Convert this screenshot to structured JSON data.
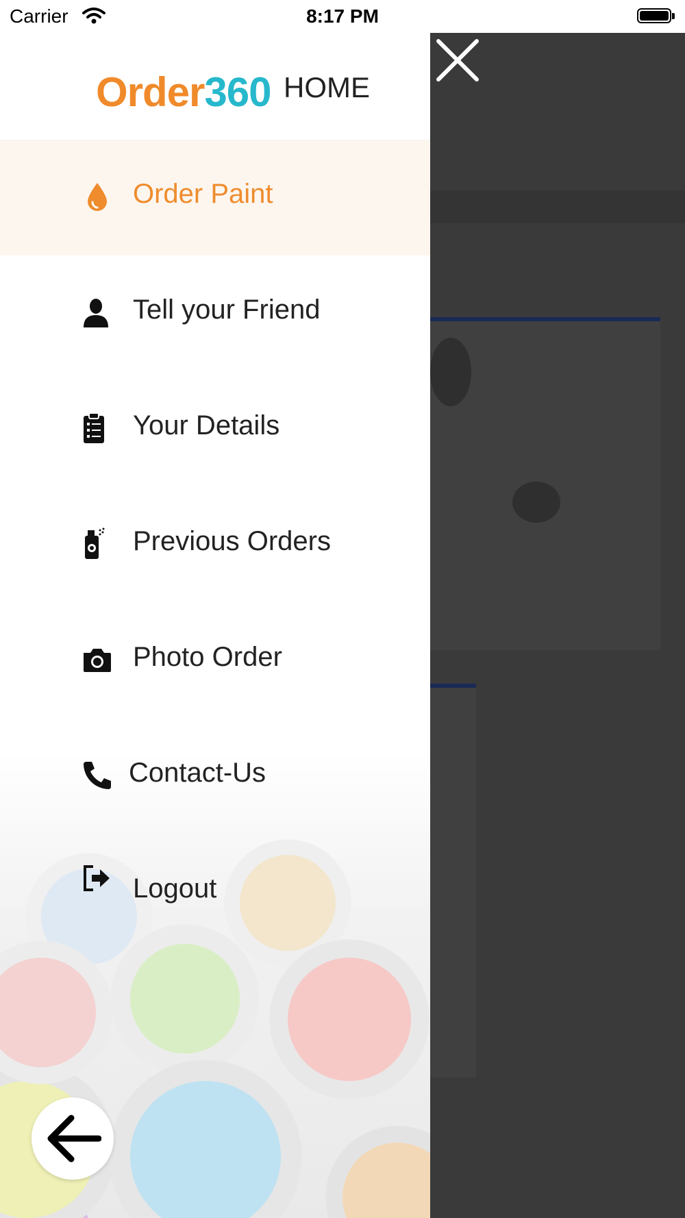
{
  "status_bar": {
    "carrier": "Carrier",
    "time": "8:17 PM"
  },
  "drawer": {
    "logo_part1": "Order",
    "logo_part2": "360",
    "home_label": "HOME",
    "items": [
      {
        "label": "Order Paint",
        "icon": "paint-drop-icon",
        "active": true
      },
      {
        "label": "Tell your Friend",
        "icon": "user-icon"
      },
      {
        "label": "Your Details",
        "icon": "clipboard-icon"
      },
      {
        "label": "Previous Orders",
        "icon": "spray-can-icon"
      },
      {
        "label": "Photo Order",
        "icon": "camera-icon"
      },
      {
        "label": "Contact-Us",
        "icon": "phone-icon"
      },
      {
        "label": "Logout",
        "icon": "logout-icon"
      }
    ]
  },
  "icons": {
    "close": "close-icon",
    "back": "back-arrow-icon"
  },
  "colors": {
    "accent_orange": "#ef8c2d",
    "accent_teal": "#27b8cc",
    "overlay": "#3a3a3a",
    "active_bg": "#fdf6ef"
  }
}
